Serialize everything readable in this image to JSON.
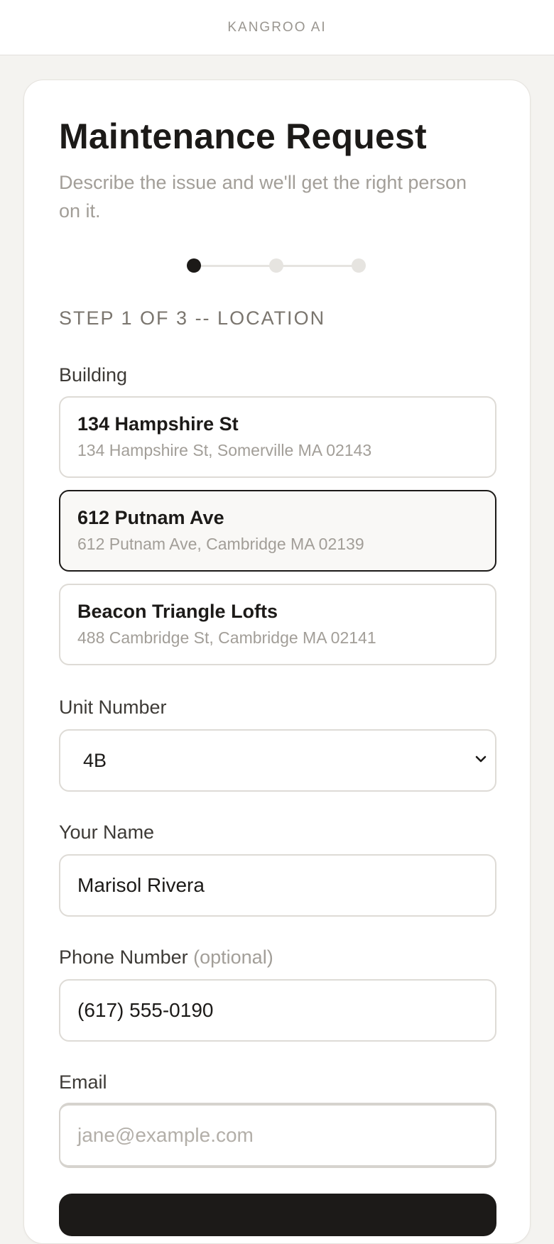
{
  "app": {
    "brand": "KANGROO AI"
  },
  "form": {
    "title": "Maintenance Request",
    "subtitle": "Describe the issue and we'll get the right person on it.",
    "step": {
      "current": 1,
      "total": 3,
      "label": "STEP 1 OF 3 -- LOCATION"
    },
    "building": {
      "label": "Building",
      "selected_index": 1,
      "options": [
        {
          "name": "134 Hampshire St",
          "address": "134 Hampshire St, Somerville MA 02143"
        },
        {
          "name": "612 Putnam Ave",
          "address": "612 Putnam Ave, Cambridge MA 02139"
        },
        {
          "name": "Beacon Triangle Lofts",
          "address": "488 Cambridge St, Cambridge MA 02141"
        }
      ]
    },
    "unit": {
      "label": "Unit Number",
      "value": "4B"
    },
    "name": {
      "label": "Your Name",
      "value": "Marisol Rivera"
    },
    "phone": {
      "label": "Phone Number",
      "optional_label": "(optional)",
      "value": "(617) 555-0190"
    },
    "email": {
      "label": "Email",
      "value": "",
      "placeholder": "jane@example.com"
    }
  },
  "colors": {
    "accent": "#1c1a18",
    "muted": "#a29e98",
    "background": "#f4f3f0",
    "border": "#dedbd6"
  }
}
